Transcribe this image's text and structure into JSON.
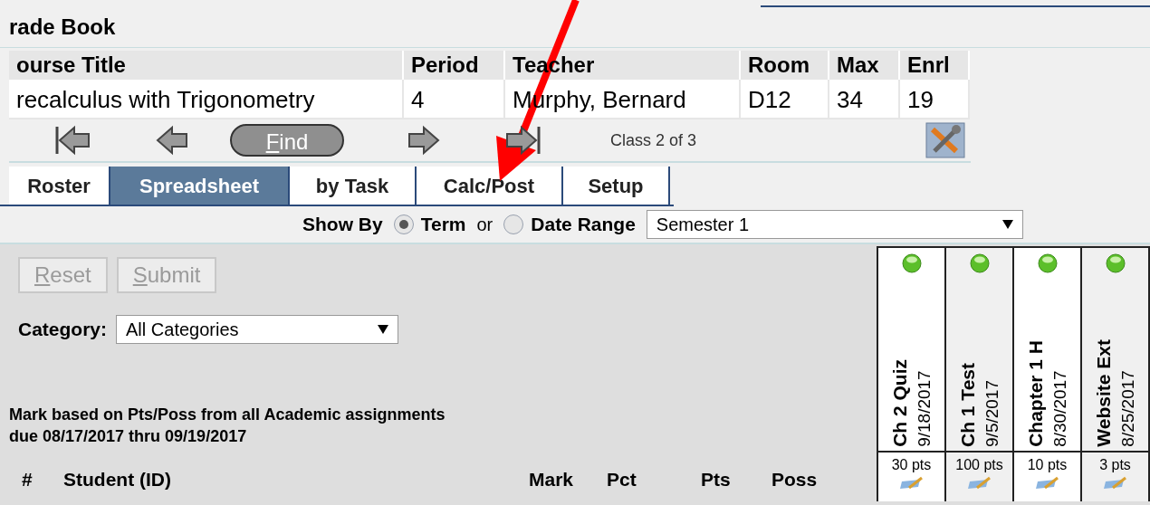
{
  "page_title": "rade Book",
  "course_table": {
    "columns": [
      "ourse Title",
      "Period",
      "Teacher",
      "Room",
      "Max",
      "Enrl"
    ],
    "row": [
      "recalculus with Trigonometry",
      "4",
      "Murphy, Bernard",
      "D12",
      "34",
      "19"
    ]
  },
  "navigation": {
    "find_label": "Find",
    "class_position": "Class 2 of 3"
  },
  "tabs": [
    {
      "label": "Roster",
      "selected": false
    },
    {
      "label": "Spreadsheet",
      "selected": true
    },
    {
      "label": "by Task",
      "selected": false
    },
    {
      "label": "Calc/Post",
      "selected": false
    },
    {
      "label": "Setup",
      "selected": false
    }
  ],
  "show_by": {
    "label": "Show By",
    "options": [
      {
        "label": "Term",
        "selected": true
      },
      {
        "label": "Date Range",
        "selected": false
      }
    ],
    "separator": "or",
    "period_select": "Semester 1"
  },
  "buttons": [
    {
      "label": "Reset",
      "disabled": true
    },
    {
      "label": "Submit",
      "disabled": true
    }
  ],
  "category": {
    "label": "Category:",
    "value": "All Categories"
  },
  "note": [
    "Mark based on Pts/Poss from all Academic assignments",
    "due 08/17/2017 thru 09/19/2017"
  ],
  "roster_columns": [
    "#",
    "Student (ID)",
    "Mark",
    "Pct",
    "Pts",
    "Poss"
  ],
  "assignments": [
    {
      "name": "Ch 2 Quiz",
      "date": "9/18/2017",
      "points": "30 pts"
    },
    {
      "name": "Ch 1 Test",
      "date": "9/5/2017",
      "points": "100 pts"
    },
    {
      "name": "Chapter 1 H",
      "date": "8/30/2017",
      "points": "10 pts"
    },
    {
      "name": "Website Ext",
      "date": "8/25/2017",
      "points": "3 pts"
    }
  ]
}
